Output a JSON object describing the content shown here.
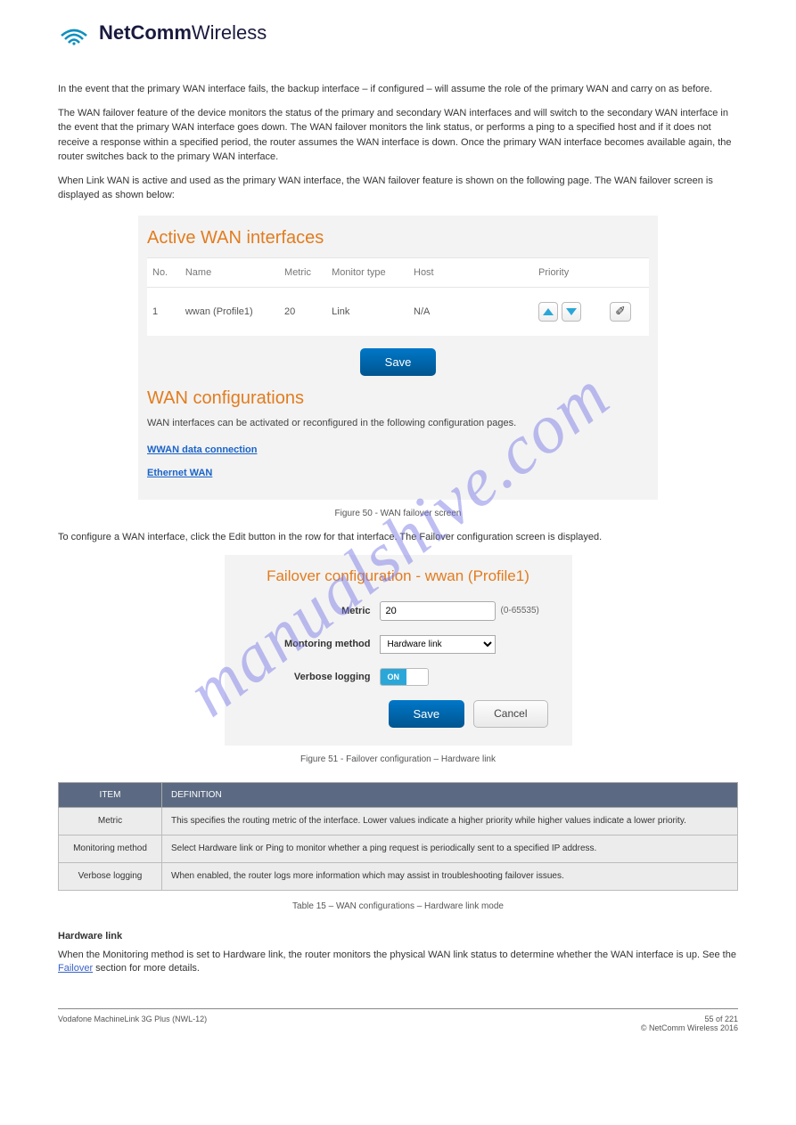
{
  "logo": {
    "bold": "NetComm",
    "light": "Wireless"
  },
  "watermark": "manualshive.com",
  "intro": {
    "p1": "In the event that the primary WAN interface fails, the backup interface – if configured – will assume the role of the primary WAN and carry on as before.",
    "p2": "The WAN failover feature of the device monitors the status of the primary and secondary WAN interfaces and will switch to the secondary WAN interface in the event that the primary WAN interface goes down. The WAN failover monitors the link status, or performs a ping to a specified host and if it does not receive a response within a specified period, the router assumes the WAN interface is down. Once the primary WAN interface becomes available again, the router switches back to the primary WAN interface.",
    "p3": "When Link WAN is active and used as the primary WAN interface, the WAN failover feature is shown on the following page. The WAN failover screen is displayed as shown below:"
  },
  "panel1": {
    "heading": "Active WAN interfaces",
    "columns": [
      "No.",
      "Name",
      "Metric",
      "Monitor type",
      "Host",
      "Priority",
      ""
    ],
    "row": {
      "no": "1",
      "name": "wwan (Profile1)",
      "metric": "20",
      "monitor": "Link",
      "host": "N/A"
    },
    "save_label": "Save",
    "sub_heading": "WAN configurations",
    "sub_desc": "WAN interfaces can be activated or reconfigured in the following configuration pages.",
    "link1": "WWAN data connection",
    "link2": "Ethernet WAN"
  },
  "caption1": "Figure 50 - WAN failover screen",
  "between": "To configure a WAN interface, click the Edit button in the row for that interface. The Failover configuration screen is displayed.",
  "panel2": {
    "heading": "Failover configuration - wwan (Profile1)",
    "metric_label": "Metric",
    "metric_value": "20",
    "metric_range": "(0-65535)",
    "method_label": "Montoring method",
    "method_value": "Hardware link",
    "verbose_label": "Verbose logging",
    "verbose_value": "ON",
    "save_label": "Save",
    "cancel_label": "Cancel"
  },
  "caption2": "Figure 51 - Failover configuration – Hardware link",
  "table": {
    "hdr_item": "ITEM",
    "hdr_def": "DEFINITION",
    "r1_item": "Metric",
    "r1_def": "This specifies the routing metric of the interface. Lower values indicate a higher priority while higher values indicate a lower priority.",
    "r2_item": "Monitoring method",
    "r2_def": "Select Hardware link or Ping to monitor whether a ping request is periodically sent to a specified IP address.",
    "r3_item": "Verbose logging",
    "r3_def": "When enabled, the router logs more information which may assist in troubleshooting failover issues."
  },
  "table_caption": "Table 15 – WAN configurations – Hardware link mode",
  "bottom": {
    "h": "Hardware link",
    "text1": "When the Monitoring method is set to Hardware link, the router monitors the physical WAN link status to determine whether the WAN interface is up. See the ",
    "link_text": "Failover",
    "text2": " section for more details."
  },
  "footer": {
    "left": "Vodafone MachineLink 3G Plus (NWL-12)",
    "right_top": "55 of 221",
    "right_bottom": "© NetComm Wireless 2016"
  }
}
